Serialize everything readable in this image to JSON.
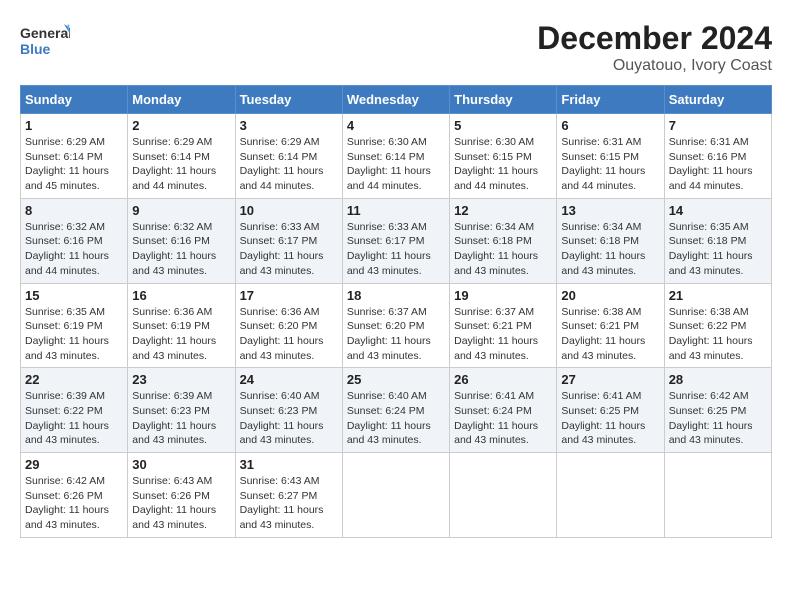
{
  "logo": {
    "line1": "General",
    "line2": "Blue"
  },
  "title": "December 2024",
  "subtitle": "Ouyatouo, Ivory Coast",
  "weekdays": [
    "Sunday",
    "Monday",
    "Tuesday",
    "Wednesday",
    "Thursday",
    "Friday",
    "Saturday"
  ],
  "weeks": [
    [
      {
        "day": "1",
        "sunrise": "6:29 AM",
        "sunset": "6:14 PM",
        "daylight": "11 hours and 45 minutes."
      },
      {
        "day": "2",
        "sunrise": "6:29 AM",
        "sunset": "6:14 PM",
        "daylight": "11 hours and 44 minutes."
      },
      {
        "day": "3",
        "sunrise": "6:29 AM",
        "sunset": "6:14 PM",
        "daylight": "11 hours and 44 minutes."
      },
      {
        "day": "4",
        "sunrise": "6:30 AM",
        "sunset": "6:14 PM",
        "daylight": "11 hours and 44 minutes."
      },
      {
        "day": "5",
        "sunrise": "6:30 AM",
        "sunset": "6:15 PM",
        "daylight": "11 hours and 44 minutes."
      },
      {
        "day": "6",
        "sunrise": "6:31 AM",
        "sunset": "6:15 PM",
        "daylight": "11 hours and 44 minutes."
      },
      {
        "day": "7",
        "sunrise": "6:31 AM",
        "sunset": "6:16 PM",
        "daylight": "11 hours and 44 minutes."
      }
    ],
    [
      {
        "day": "8",
        "sunrise": "6:32 AM",
        "sunset": "6:16 PM",
        "daylight": "11 hours and 44 minutes."
      },
      {
        "day": "9",
        "sunrise": "6:32 AM",
        "sunset": "6:16 PM",
        "daylight": "11 hours and 43 minutes."
      },
      {
        "day": "10",
        "sunrise": "6:33 AM",
        "sunset": "6:17 PM",
        "daylight": "11 hours and 43 minutes."
      },
      {
        "day": "11",
        "sunrise": "6:33 AM",
        "sunset": "6:17 PM",
        "daylight": "11 hours and 43 minutes."
      },
      {
        "day": "12",
        "sunrise": "6:34 AM",
        "sunset": "6:18 PM",
        "daylight": "11 hours and 43 minutes."
      },
      {
        "day": "13",
        "sunrise": "6:34 AM",
        "sunset": "6:18 PM",
        "daylight": "11 hours and 43 minutes."
      },
      {
        "day": "14",
        "sunrise": "6:35 AM",
        "sunset": "6:18 PM",
        "daylight": "11 hours and 43 minutes."
      }
    ],
    [
      {
        "day": "15",
        "sunrise": "6:35 AM",
        "sunset": "6:19 PM",
        "daylight": "11 hours and 43 minutes."
      },
      {
        "day": "16",
        "sunrise": "6:36 AM",
        "sunset": "6:19 PM",
        "daylight": "11 hours and 43 minutes."
      },
      {
        "day": "17",
        "sunrise": "6:36 AM",
        "sunset": "6:20 PM",
        "daylight": "11 hours and 43 minutes."
      },
      {
        "day": "18",
        "sunrise": "6:37 AM",
        "sunset": "6:20 PM",
        "daylight": "11 hours and 43 minutes."
      },
      {
        "day": "19",
        "sunrise": "6:37 AM",
        "sunset": "6:21 PM",
        "daylight": "11 hours and 43 minutes."
      },
      {
        "day": "20",
        "sunrise": "6:38 AM",
        "sunset": "6:21 PM",
        "daylight": "11 hours and 43 minutes."
      },
      {
        "day": "21",
        "sunrise": "6:38 AM",
        "sunset": "6:22 PM",
        "daylight": "11 hours and 43 minutes."
      }
    ],
    [
      {
        "day": "22",
        "sunrise": "6:39 AM",
        "sunset": "6:22 PM",
        "daylight": "11 hours and 43 minutes."
      },
      {
        "day": "23",
        "sunrise": "6:39 AM",
        "sunset": "6:23 PM",
        "daylight": "11 hours and 43 minutes."
      },
      {
        "day": "24",
        "sunrise": "6:40 AM",
        "sunset": "6:23 PM",
        "daylight": "11 hours and 43 minutes."
      },
      {
        "day": "25",
        "sunrise": "6:40 AM",
        "sunset": "6:24 PM",
        "daylight": "11 hours and 43 minutes."
      },
      {
        "day": "26",
        "sunrise": "6:41 AM",
        "sunset": "6:24 PM",
        "daylight": "11 hours and 43 minutes."
      },
      {
        "day": "27",
        "sunrise": "6:41 AM",
        "sunset": "6:25 PM",
        "daylight": "11 hours and 43 minutes."
      },
      {
        "day": "28",
        "sunrise": "6:42 AM",
        "sunset": "6:25 PM",
        "daylight": "11 hours and 43 minutes."
      }
    ],
    [
      {
        "day": "29",
        "sunrise": "6:42 AM",
        "sunset": "6:26 PM",
        "daylight": "11 hours and 43 minutes."
      },
      {
        "day": "30",
        "sunrise": "6:43 AM",
        "sunset": "6:26 PM",
        "daylight": "11 hours and 43 minutes."
      },
      {
        "day": "31",
        "sunrise": "6:43 AM",
        "sunset": "6:27 PM",
        "daylight": "11 hours and 43 minutes."
      },
      null,
      null,
      null,
      null
    ]
  ],
  "labels": {
    "sunrise": "Sunrise:",
    "sunset": "Sunset:",
    "daylight": "Daylight:"
  }
}
